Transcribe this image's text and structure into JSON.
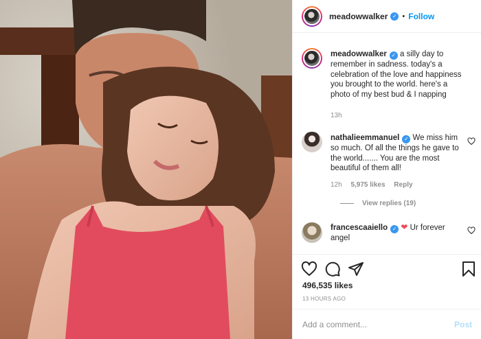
{
  "post": {
    "photo_alt": "photo",
    "author": "meadowwalker",
    "follow_label": "Follow",
    "dot": "•"
  },
  "caption": {
    "username": "meadowwalker",
    "text": " a silly day to remember in sadness. today's a celebration of the love and happiness you brought to the world. here's a photo of my best bud & I napping",
    "time": "13h"
  },
  "comments": [
    {
      "username": "nathalieemmanuel",
      "text": " We miss him so much. Of all the things he gave to the world....... You are the most beautiful of them all!",
      "time": "12h",
      "likes": "5,975 likes",
      "reply": "Reply",
      "view_replies": "View replies (19)"
    },
    {
      "username": "francescaaiello",
      "text": " Ur forever angel",
      "heart": "❤"
    }
  ],
  "actions": {
    "likes": "496,535 likes",
    "timestamp": "13 HOURS AGO"
  },
  "compose": {
    "placeholder": "Add a comment...",
    "post_label": "Post"
  },
  "icons": {
    "verified": "✓",
    "like": "heart-icon",
    "comment": "comment-icon",
    "share": "paper-plane-icon",
    "save": "bookmark-icon"
  },
  "colors": {
    "link_blue": "#0095f6",
    "verified_blue": "#3897f0",
    "muted": "#8e8e8e",
    "heart_red": "#ed4956"
  }
}
